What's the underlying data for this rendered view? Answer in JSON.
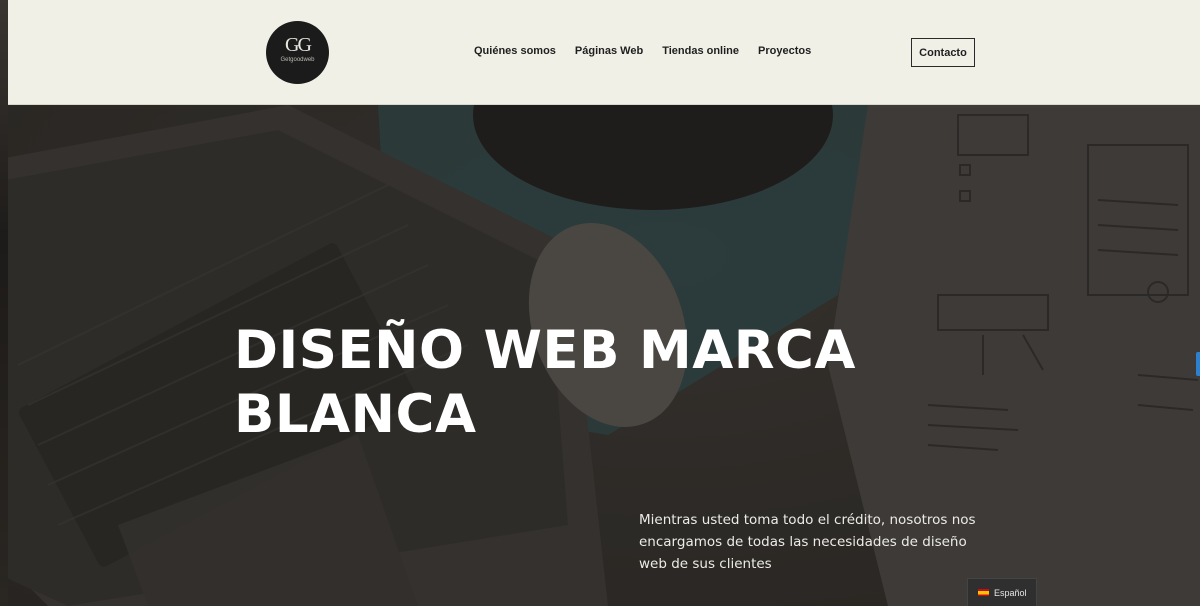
{
  "header": {
    "logo_mark": "GG",
    "logo_text": "Getgoodweb",
    "nav": [
      "Quiénes somos",
      "Páginas Web",
      "Tiendas online",
      "Proyectos"
    ],
    "contact_label": "Contacto"
  },
  "hero": {
    "title_line1": "DISEÑO WEB MARCA",
    "title_line2": "BLANCA",
    "subtitle": "Mientras usted toma todo el crédito, nosotros nos encargamos de todas las necesidades de diseño web de sus clientes"
  },
  "language_switcher": {
    "label": "Español",
    "flag_icon": "spain-flag-icon"
  },
  "colors": {
    "header_bg": "#f1f0e7",
    "hero_overlay": "#33302c",
    "accent": "#2d7fd0"
  }
}
